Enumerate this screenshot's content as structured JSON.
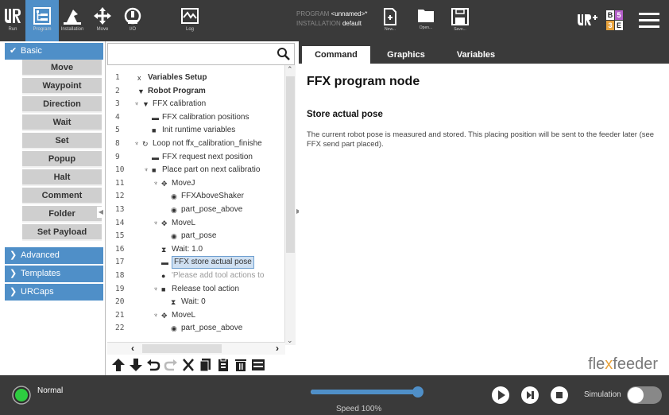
{
  "header": {
    "nav_buttons": [
      {
        "label": "Run",
        "icon": "ur-logo-icon"
      },
      {
        "label": "Program",
        "icon": "program-tree-icon"
      },
      {
        "label": "Installation",
        "icon": "installation-icon"
      },
      {
        "label": "Move",
        "icon": "move-arrows-icon"
      },
      {
        "label": "I/O",
        "icon": "io-icon"
      },
      {
        "label": "Log",
        "icon": "log-chart-icon"
      }
    ],
    "program_label": "PROGRAM",
    "program_value": "<unnamed>*",
    "installation_label": "INSTALLATION",
    "installation_value": "default",
    "file_buttons": [
      {
        "label": "New...",
        "icon": "new-file-icon"
      },
      {
        "label": "Open...",
        "icon": "open-folder-icon"
      },
      {
        "label": "Save...",
        "icon": "save-icon"
      }
    ],
    "version_badge": [
      "B",
      "5",
      "3",
      "E"
    ]
  },
  "left_nav": {
    "basic_label": "Basic",
    "basic_items": [
      "Move",
      "Waypoint",
      "Direction",
      "Wait",
      "Set",
      "Popup",
      "Halt",
      "Comment",
      "Folder",
      "Set Payload"
    ],
    "groups": [
      "Advanced",
      "Templates",
      "URCaps"
    ]
  },
  "tree": {
    "search_placeholder": "",
    "rows": [
      {
        "num": "1",
        "text": "Variables Setup",
        "icon": "x",
        "bold": true
      },
      {
        "num": "2",
        "text": "Robot Program",
        "icon": "▼",
        "bold": true
      },
      {
        "num": "3",
        "text": "FFX calibration",
        "icon": "▼"
      },
      {
        "num": "4",
        "text": "FFX calibration positions",
        "icon": "▬"
      },
      {
        "num": "5",
        "text": "Init runtime variables",
        "icon": "■"
      },
      {
        "num": "8",
        "text": "Loop not ffx_calibration_finishe",
        "icon": "↻"
      },
      {
        "num": "9",
        "text": "FFX request next position",
        "icon": "▬"
      },
      {
        "num": "10",
        "text": "Place part on next calibratio",
        "icon": "■"
      },
      {
        "num": "11",
        "text": "MoveJ",
        "icon": "✥"
      },
      {
        "num": "12",
        "text": "FFXAboveShaker",
        "icon": "◉"
      },
      {
        "num": "13",
        "text": "part_pose_above",
        "icon": "◉"
      },
      {
        "num": "14",
        "text": "MoveL",
        "icon": "✥"
      },
      {
        "num": "15",
        "text": "part_pose",
        "icon": "◉"
      },
      {
        "num": "16",
        "text": "Wait: 1.0",
        "icon": "⧗"
      },
      {
        "num": "17",
        "text": "FFX store actual pose",
        "icon": "▬"
      },
      {
        "num": "18",
        "text": "'Please add tool actions to",
        "icon": "●"
      },
      {
        "num": "19",
        "text": "Release tool action",
        "icon": "■"
      },
      {
        "num": "20",
        "text": "Wait: 0",
        "icon": "⧗"
      },
      {
        "num": "21",
        "text": "MoveL",
        "icon": "✥"
      },
      {
        "num": "22",
        "text": "part_pose_above",
        "icon": "◉"
      }
    ]
  },
  "tabs": [
    "Command",
    "Graphics",
    "Variables"
  ],
  "content": {
    "node_title": "FFX program node",
    "section_title": "Store actual pose",
    "description": "The current robot pose is measured and stored. This placing position will be sent to the feeder later (see FFX send part placed).",
    "brand_pre": "fle",
    "brand_x": "x",
    "brand_post": "feeder"
  },
  "footer": {
    "mode": "Normal",
    "speed": "Speed 100%",
    "speed_fraction": 1.0,
    "simulation": "Simulation"
  },
  "colors": {
    "accent": "#4f8fc8",
    "dark": "#3a3a3a",
    "status_green": "#2ecc40",
    "brand_orange": "#e8a33d"
  }
}
